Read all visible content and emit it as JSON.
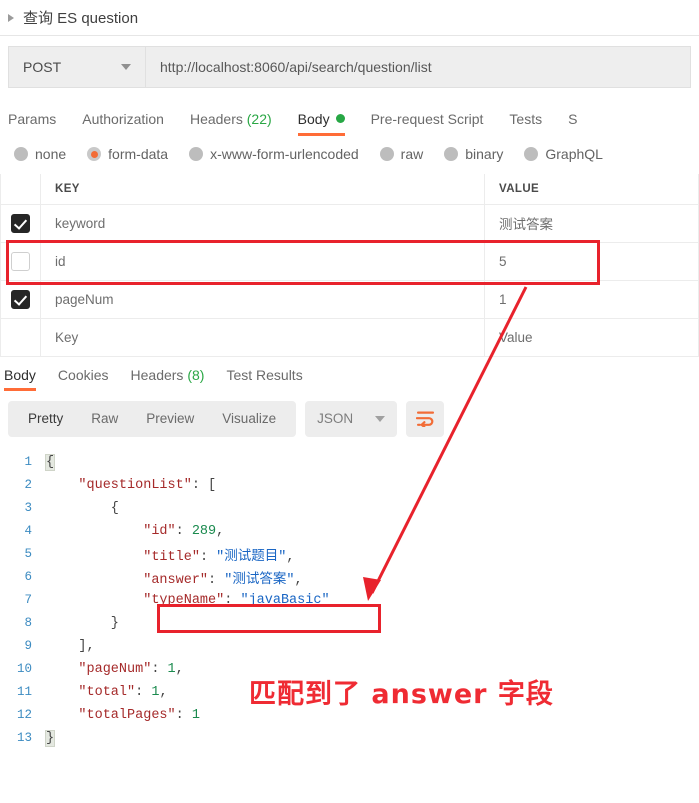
{
  "request": {
    "title": "查询 ES question",
    "method": "POST",
    "url": "http://localhost:8060/api/search/question/list",
    "tabs": [
      {
        "label": "Params",
        "active": false
      },
      {
        "label": "Authorization",
        "active": false
      },
      {
        "label": "Headers",
        "count": "(22)",
        "active": false
      },
      {
        "label": "Body",
        "active": true,
        "dot": true
      },
      {
        "label": "Pre-request Script",
        "active": false
      },
      {
        "label": "Tests",
        "active": false
      },
      {
        "label": "S",
        "active": false
      }
    ],
    "body_types": [
      {
        "label": "none",
        "selected": false
      },
      {
        "label": "form-data",
        "selected": true
      },
      {
        "label": "x-www-form-urlencoded",
        "selected": false
      },
      {
        "label": "raw",
        "selected": false
      },
      {
        "label": "binary",
        "selected": false
      },
      {
        "label": "GraphQL",
        "selected": false
      }
    ],
    "table": {
      "headers": {
        "key": "KEY",
        "value": "VALUE"
      },
      "rows": [
        {
          "checked": true,
          "key": "keyword",
          "value": "测试答案",
          "placeholder": false
        },
        {
          "checked": false,
          "key": "id",
          "value": "5",
          "placeholder": false
        },
        {
          "checked": true,
          "key": "pageNum",
          "value": "1",
          "placeholder": false
        },
        {
          "checked": false,
          "key": "Key",
          "value": "Value",
          "placeholder": true
        }
      ]
    }
  },
  "response": {
    "tabs": [
      {
        "label": "Body",
        "active": true
      },
      {
        "label": "Cookies",
        "active": false
      },
      {
        "label": "Headers",
        "count": "(8)",
        "active": false
      },
      {
        "label": "Test Results",
        "active": false
      }
    ],
    "view_modes": [
      {
        "label": "Pretty",
        "active": true
      },
      {
        "label": "Raw",
        "active": false
      },
      {
        "label": "Preview",
        "active": false
      },
      {
        "label": "Visualize",
        "active": false
      }
    ],
    "format": "JSON",
    "wrap_icon": "wrap-text-icon",
    "json_lines": [
      {
        "n": "1",
        "tokens": [
          {
            "t": "{",
            "c": "p",
            "hl": true
          }
        ]
      },
      {
        "n": "2",
        "tokens": [
          {
            "t": "    \"questionList\"",
            "c": "k"
          },
          {
            "t": ": [",
            "c": "p"
          }
        ]
      },
      {
        "n": "3",
        "tokens": [
          {
            "t": "        {",
            "c": "p"
          }
        ]
      },
      {
        "n": "4",
        "tokens": [
          {
            "t": "            \"id\"",
            "c": "k"
          },
          {
            "t": ": ",
            "c": "p"
          },
          {
            "t": "289",
            "c": "n"
          },
          {
            "t": ",",
            "c": "p"
          }
        ]
      },
      {
        "n": "5",
        "tokens": [
          {
            "t": "            \"title\"",
            "c": "k"
          },
          {
            "t": ": ",
            "c": "p"
          },
          {
            "t": "\"测试题目\"",
            "c": "s"
          },
          {
            "t": ",",
            "c": "p"
          }
        ]
      },
      {
        "n": "6",
        "tokens": [
          {
            "t": "            \"answer\"",
            "c": "k"
          },
          {
            "t": ": ",
            "c": "p"
          },
          {
            "t": "\"测试答案\"",
            "c": "s"
          },
          {
            "t": ",",
            "c": "p"
          }
        ]
      },
      {
        "n": "7",
        "tokens": [
          {
            "t": "            \"typeName\"",
            "c": "k"
          },
          {
            "t": ": ",
            "c": "p"
          },
          {
            "t": "\"javaBasic\"",
            "c": "s"
          }
        ]
      },
      {
        "n": "8",
        "tokens": [
          {
            "t": "        }",
            "c": "p"
          }
        ]
      },
      {
        "n": "9",
        "tokens": [
          {
            "t": "    ],",
            "c": "p"
          }
        ]
      },
      {
        "n": "10",
        "tokens": [
          {
            "t": "    \"pageNum\"",
            "c": "k"
          },
          {
            "t": ": ",
            "c": "p"
          },
          {
            "t": "1",
            "c": "n"
          },
          {
            "t": ",",
            "c": "p"
          }
        ]
      },
      {
        "n": "11",
        "tokens": [
          {
            "t": "    \"total\"",
            "c": "k"
          },
          {
            "t": ": ",
            "c": "p"
          },
          {
            "t": "1",
            "c": "n"
          },
          {
            "t": ",",
            "c": "p"
          }
        ]
      },
      {
        "n": "12",
        "tokens": [
          {
            "t": "    \"totalPages\"",
            "c": "k"
          },
          {
            "t": ": ",
            "c": "p"
          },
          {
            "t": "1",
            "c": "n"
          }
        ]
      },
      {
        "n": "13",
        "tokens": [
          {
            "t": "}",
            "c": "p",
            "hl": true
          }
        ]
      }
    ]
  },
  "annotations": {
    "text": "匹配到了 answer 字段",
    "color": "#ef2b33",
    "box_color": "#e8222c"
  }
}
